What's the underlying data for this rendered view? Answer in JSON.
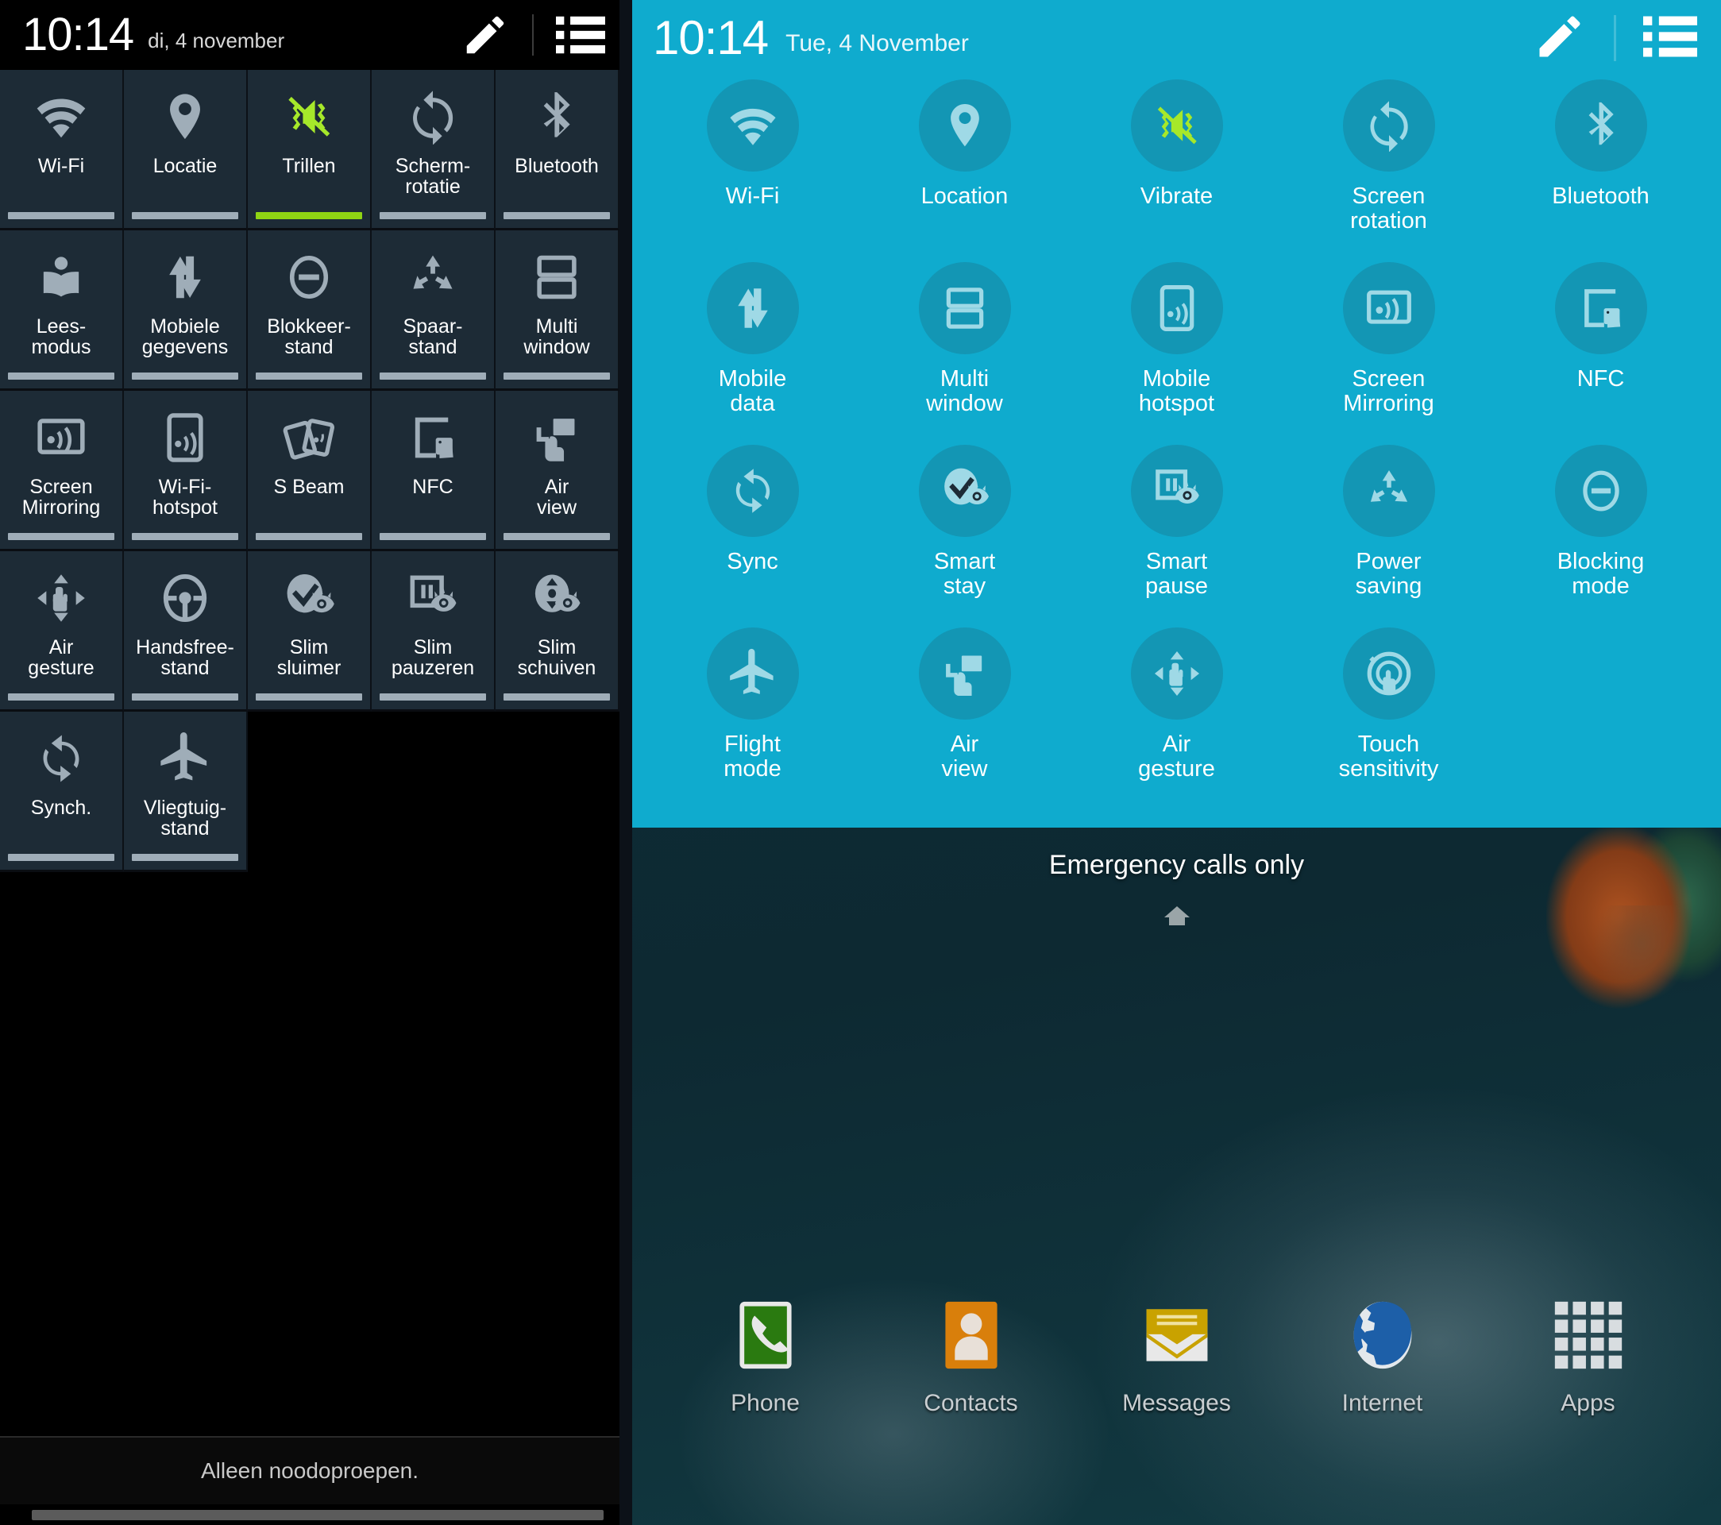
{
  "left_panel": {
    "lang": "nl",
    "status_bar": {
      "time": "10:14",
      "date": "di, 4 november"
    },
    "header_actions": [
      {
        "name": "edit-pencil-icon",
        "label": "Bewerken"
      },
      {
        "name": "list-icon",
        "label": "Lijst"
      }
    ],
    "tiles": [
      {
        "label": "Wi-Fi",
        "icon": "wifi-icon",
        "on": false
      },
      {
        "label": "Locatie",
        "icon": "location-pin-icon",
        "on": false
      },
      {
        "label": "Trillen",
        "icon": "vibrate-icon",
        "on": true
      },
      {
        "label": "Scherm-\nrotatie",
        "icon": "screen-rotation-icon",
        "on": false
      },
      {
        "label": "Bluetooth",
        "icon": "bluetooth-icon",
        "on": false
      },
      {
        "label": "Lees-\nmodus",
        "icon": "reading-mode-icon",
        "on": false
      },
      {
        "label": "Mobiele\ngegevens",
        "icon": "mobile-data-icon",
        "on": false
      },
      {
        "label": "Blokkeer-\nstand",
        "icon": "blocking-mode-icon",
        "on": false
      },
      {
        "label": "Spaar-\nstand",
        "icon": "power-saving-icon",
        "on": false
      },
      {
        "label": "Multi\nwindow",
        "icon": "multi-window-icon",
        "on": false
      },
      {
        "label": "Screen\nMirroring",
        "icon": "screen-mirroring-icon",
        "on": false
      },
      {
        "label": "Wi-Fi-\nhotspot",
        "icon": "mobile-hotspot-icon",
        "on": false
      },
      {
        "label": "S Beam",
        "icon": "s-beam-icon",
        "on": false
      },
      {
        "label": "NFC",
        "icon": "nfc-icon",
        "on": false
      },
      {
        "label": "Air\nview",
        "icon": "air-view-icon",
        "on": false
      },
      {
        "label": "Air\ngesture",
        "icon": "air-gesture-icon",
        "on": false
      },
      {
        "label": "Handsfree-\nstand",
        "icon": "hands-free-icon",
        "on": false
      },
      {
        "label": "Slim\nsluimer",
        "icon": "smart-stay-icon",
        "on": false
      },
      {
        "label": "Slim\npauzeren",
        "icon": "smart-pause-icon",
        "on": false
      },
      {
        "label": "Slim\nschuiven",
        "icon": "smart-scroll-icon",
        "on": false
      },
      {
        "label": "Synch.",
        "icon": "sync-icon",
        "on": false
      },
      {
        "label": "Vliegtuig-\nstand",
        "icon": "flight-mode-icon",
        "on": false
      }
    ],
    "emergency_text": "Alleen noodoproepen.",
    "colors": {
      "tile_bg": "#1d2b36",
      "bar_off": "#9fadb8",
      "bar_on": "#8fd413",
      "accent_green": "#a6e82a"
    }
  },
  "right_panel": {
    "lang": "en",
    "status_bar": {
      "time": "10:14",
      "date": "Tue, 4 November"
    },
    "header_actions": [
      {
        "name": "edit-pencil-icon",
        "label": "Edit"
      },
      {
        "name": "list-icon",
        "label": "List"
      }
    ],
    "tiles": [
      {
        "label": "Wi-Fi",
        "icon": "wifi-icon",
        "on": false
      },
      {
        "label": "Location",
        "icon": "location-pin-icon",
        "on": false
      },
      {
        "label": "Vibrate",
        "icon": "vibrate-icon",
        "on": true
      },
      {
        "label": "Screen\nrotation",
        "icon": "screen-rotation-icon",
        "on": false
      },
      {
        "label": "Bluetooth",
        "icon": "bluetooth-icon",
        "on": false
      },
      {
        "label": "Mobile\ndata",
        "icon": "mobile-data-icon",
        "on": false
      },
      {
        "label": "Multi\nwindow",
        "icon": "multi-window-icon",
        "on": false
      },
      {
        "label": "Mobile\nhotspot",
        "icon": "mobile-hotspot-icon",
        "on": false
      },
      {
        "label": "Screen\nMirroring",
        "icon": "screen-mirroring-icon",
        "on": false
      },
      {
        "label": "NFC",
        "icon": "nfc-icon",
        "on": false
      },
      {
        "label": "Sync",
        "icon": "sync-icon",
        "on": false
      },
      {
        "label": "Smart\nstay",
        "icon": "smart-stay-icon",
        "on": false
      },
      {
        "label": "Smart\npause",
        "icon": "smart-pause-icon",
        "on": false
      },
      {
        "label": "Power\nsaving",
        "icon": "power-saving-icon",
        "on": false
      },
      {
        "label": "Blocking\nmode",
        "icon": "blocking-mode-icon",
        "on": false
      },
      {
        "label": "Flight\nmode",
        "icon": "flight-mode-icon",
        "on": false
      },
      {
        "label": "Air\nview",
        "icon": "air-view-icon",
        "on": false
      },
      {
        "label": "Air\ngesture",
        "icon": "air-gesture-icon",
        "on": false
      },
      {
        "label": "Touch\nsensitivity",
        "icon": "touch-sensitivity-icon",
        "on": false
      }
    ],
    "emergency_text": "Emergency calls only",
    "home_indicator": "home-page-indicator",
    "dock": [
      {
        "label": "Phone",
        "icon": "phone-icon",
        "color": "#2a7a10"
      },
      {
        "label": "Contacts",
        "icon": "contacts-icon",
        "color": "#d97f0b"
      },
      {
        "label": "Messages",
        "icon": "messages-icon",
        "color": "#c9a200"
      },
      {
        "label": "Internet",
        "icon": "internet-globe-icon",
        "color": "#1d5fa8"
      },
      {
        "label": "Apps",
        "icon": "apps-grid-icon",
        "color": "#d8dde0"
      }
    ],
    "colors": {
      "panel_bg": "#0fabce",
      "circle_bg": "#1396b4",
      "icon": "#9fd9e6",
      "accent_green": "#a6e82a"
    }
  }
}
